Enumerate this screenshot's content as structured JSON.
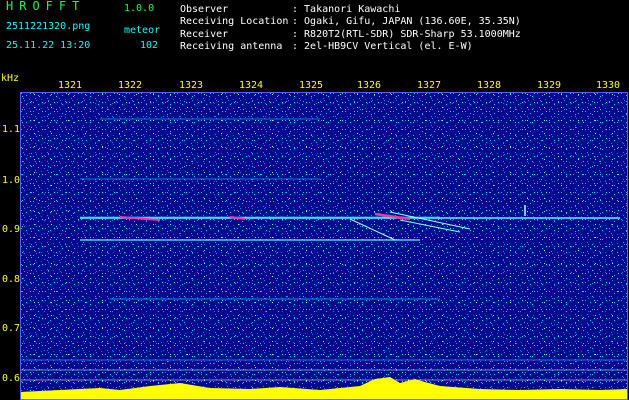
{
  "header": {
    "app_title": "HROFFT",
    "version": "1.0.0",
    "filename": "2511221320.png",
    "mode": "meteor",
    "datetime": "25.11.22 13:20",
    "count": "102"
  },
  "meta": [
    {
      "key": "Observer",
      "value": ": Takanori Kawachi"
    },
    {
      "key": "Receiving Location",
      "value": ": Ogaki, Gifu, JAPAN (136.60E, 35.35N)"
    },
    {
      "key": "Receiver",
      "value": ": R820T2(RTL-SDR) SDR-Sharp 53.1000MHz"
    },
    {
      "key": "Receiving antenna",
      "value": ": 2el-HB9CV Vertical (el. E-W)"
    }
  ],
  "axes": {
    "y_unit": "kHz",
    "x_ticks": [
      "1321",
      "1322",
      "1323",
      "1324",
      "1325",
      "1326",
      "1327",
      "1328",
      "1329",
      "1330"
    ],
    "y_ticks": [
      "1.1",
      "1.0",
      "0.9",
      "0.8",
      "0.7",
      "0.6"
    ]
  },
  "colors": {
    "background": "#000000",
    "label": "#ffff00",
    "meta": "#ffffff",
    "title": "#00ff60",
    "spectrogram_base": "#000a8c",
    "noise": "#00ffff",
    "echo": "#ff3399"
  }
}
